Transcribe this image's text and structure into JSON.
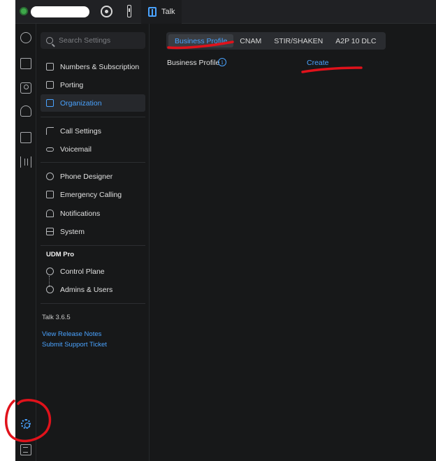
{
  "topbar": {
    "app_tab_label": "Talk",
    "icons": [
      "globe-icon",
      "target-icon",
      "device-icon",
      "talk-icon"
    ]
  },
  "rail": {
    "icons": [
      "dashboard-icon",
      "directory-icon",
      "contacts-icon",
      "support-icon",
      "address-book-icon",
      "voice-icon",
      "settings-gear-icon",
      "logs-icon"
    ]
  },
  "sidebar": {
    "search_placeholder": "Search Settings",
    "items": [
      {
        "label": "Numbers & Subscription",
        "icon": "numbers-icon"
      },
      {
        "label": "Porting",
        "icon": "porting-icon"
      },
      {
        "label": "Organization",
        "icon": "organization-icon",
        "active": true
      },
      {
        "label": "Call Settings",
        "icon": "phone-icon"
      },
      {
        "label": "Voicemail",
        "icon": "voicemail-icon"
      },
      {
        "label": "Phone Designer",
        "icon": "phone-designer-icon"
      },
      {
        "label": "Emergency Calling",
        "icon": "emergency-icon"
      },
      {
        "label": "Notifications",
        "icon": "bell-icon"
      },
      {
        "label": "System",
        "icon": "server-icon"
      }
    ],
    "udm_section_label": "UDM Pro",
    "udm_items": [
      {
        "label": "Control Plane",
        "icon": "control-plane-icon"
      },
      {
        "label": "Admins & Users",
        "icon": "admins-icon"
      }
    ],
    "version": "Talk 3.6.5",
    "links": [
      "View Release Notes",
      "Submit Support Ticket"
    ]
  },
  "main": {
    "tabs": [
      {
        "label": "Business Profile",
        "active": true
      },
      {
        "label": "CNAM"
      },
      {
        "label": "STIR/SHAKEN"
      },
      {
        "label": "A2P 10 DLC"
      }
    ],
    "field_label": "Business Profile",
    "info_icon": "info-icon",
    "action_link": "Create"
  },
  "colors": {
    "accent": "#4aa3ff",
    "background": "#171819",
    "annotation": "#e0121b"
  }
}
